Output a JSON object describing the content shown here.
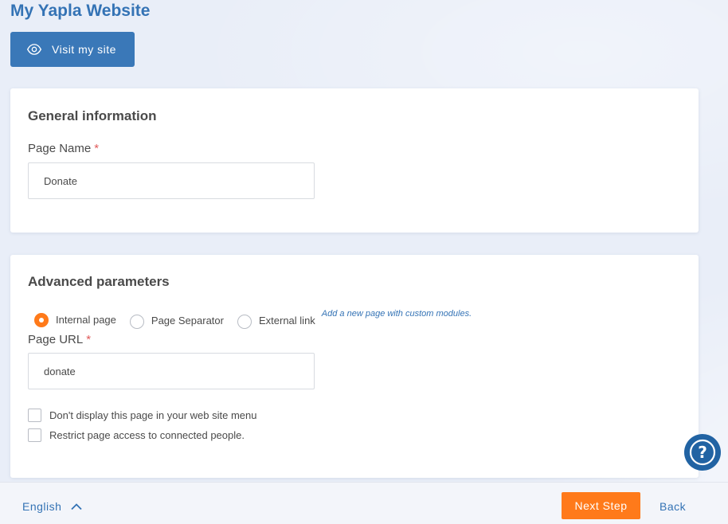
{
  "header": {
    "title": "My Yapla Website",
    "visit_button_label": "Visit my site",
    "visit_icon": "eye-icon"
  },
  "general": {
    "title": "General information",
    "page_name_label": "Page Name",
    "required_mark": "*",
    "page_name_value": "Donate"
  },
  "advanced": {
    "title": "Advanced parameters",
    "page_types": [
      {
        "label": "Internal page",
        "checked": true
      },
      {
        "label": "Page Separator",
        "checked": false
      },
      {
        "label": "External link",
        "checked": false
      }
    ],
    "page_type_hint": "Add a new page with custom modules.",
    "page_url_label": "Page URL",
    "required_mark": "*",
    "page_url_value": "donate",
    "options": [
      {
        "label": "Don't display this page in your web site menu",
        "checked": false
      },
      {
        "label": "Restrict page access to connected people.",
        "checked": false
      }
    ]
  },
  "help": {
    "icon": "question-mark-icon",
    "glyph": "?"
  },
  "footer": {
    "language": "English",
    "language_icon": "chevron-up-icon",
    "next_label": "Next Step",
    "back_label": "Back"
  },
  "colors": {
    "primary_blue": "#3a78b8",
    "title_blue": "#3473b5",
    "accent_orange": "#ff7a1a",
    "help_blue": "#2163a3",
    "required_red": "#e05a5a",
    "background": "#e9eef8"
  }
}
